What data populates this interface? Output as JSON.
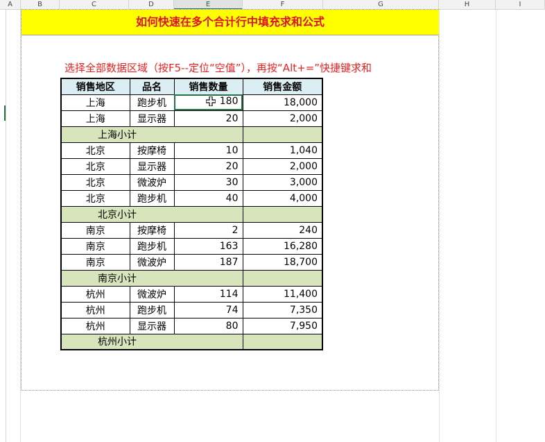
{
  "columns": [
    "A",
    "B",
    "C",
    "D",
    "E",
    "F",
    "G",
    "H",
    "I"
  ],
  "selected_column": "E",
  "title": "如何快速在多个合计行中填充求和公式",
  "instruction": "选择全部数据区域（按F5--定位“空值”），再按“Alt+=”快捷键求和",
  "headers": [
    "销售地区",
    "品名",
    "销售数量",
    "销售金额"
  ],
  "rows": [
    {
      "region": "上海",
      "product": "跑步机",
      "qty": "180",
      "amount": "18,000",
      "active": true
    },
    {
      "region": "上海",
      "product": "显示器",
      "qty": "20",
      "amount": "2,000"
    },
    {
      "subtotal": "上海小计"
    },
    {
      "region": "北京",
      "product": "按摩椅",
      "qty": "10",
      "amount": "1,040"
    },
    {
      "region": "北京",
      "product": "显示器",
      "qty": "20",
      "amount": "2,000"
    },
    {
      "region": "北京",
      "product": "微波炉",
      "qty": "30",
      "amount": "3,000"
    },
    {
      "region": "北京",
      "product": "跑步机",
      "qty": "40",
      "amount": "4,000"
    },
    {
      "subtotal": "北京小计"
    },
    {
      "region": "南京",
      "product": "按摩椅",
      "qty": "2",
      "amount": "240"
    },
    {
      "region": "南京",
      "product": "跑步机",
      "qty": "163",
      "amount": "16,280"
    },
    {
      "region": "南京",
      "product": "微波炉",
      "qty": "187",
      "amount": "18,700"
    },
    {
      "subtotal": "南京小计"
    },
    {
      "region": "杭州",
      "product": "微波炉",
      "qty": "114",
      "amount": "11,400"
    },
    {
      "region": "杭州",
      "product": "跑步机",
      "qty": "74",
      "amount": "7,350"
    },
    {
      "region": "杭州",
      "product": "显示器",
      "qty": "80",
      "amount": "7,950"
    },
    {
      "subtotal": "杭州小计"
    }
  ],
  "cursor_icon": "cell-select-cross-icon",
  "colors": {
    "title_bg": "#ffff00",
    "title_text": "#e0102a",
    "header_bg": "#dbeef3",
    "subtotal_bg": "#d8e4bc",
    "accent": "#217346"
  }
}
